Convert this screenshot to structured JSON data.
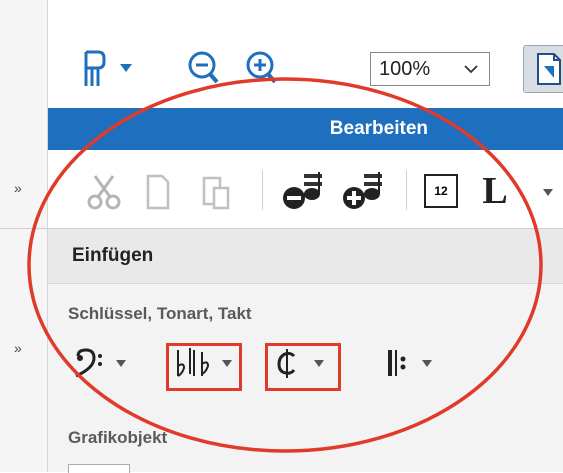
{
  "toolbar": {
    "zoom_value": "100%"
  },
  "header": {
    "title": "Bearbeiten"
  },
  "sections": {
    "insert_label": "Einfügen",
    "group_clef_key_time": "Schlüssel, Tonart, Takt",
    "group_graphic": "Grafikobjekt"
  },
  "left_strip": {
    "expand_glyph_1": "»",
    "expand_glyph_2": "»"
  },
  "icons": {
    "page_layout": "page-layout-icon",
    "zoom_out": "zoom-out-icon",
    "zoom_in": "zoom-in-icon",
    "page_view": "page-view-icon",
    "cut": "cut-icon",
    "copy": "copy-icon",
    "paste": "paste-icon",
    "note_remove": "note-remove-icon",
    "note_add": "note-add-icon",
    "measure_number": "measure-number-icon",
    "text": "text-icon",
    "clef": "clef-icon",
    "key_signature": "key-signature-icon",
    "time_signature": "time-signature-icon",
    "repeat": "repeat-icon"
  },
  "measure_box_text": "12",
  "text_tool_glyph": "L",
  "colors": {
    "accent_blue": "#1f6fbf",
    "icon_blue": "#1f6fbf",
    "annotation_red": "#e03a2a"
  }
}
